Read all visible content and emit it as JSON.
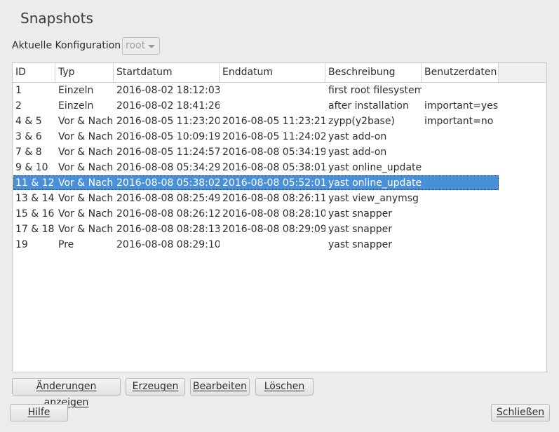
{
  "window": {
    "title": "Snapshots"
  },
  "config": {
    "label": "Aktuelle Konfiguration",
    "value": "root"
  },
  "table": {
    "columns": [
      "ID",
      "Typ",
      "Startdatum",
      "Enddatum",
      "Beschreibung",
      "Benutzerdaten"
    ],
    "rows": [
      [
        "1",
        "Einzeln",
        "2016-08-02 18:12:03",
        "",
        "first root filesystem",
        ""
      ],
      [
        "2",
        "Einzeln",
        "2016-08-02 18:41:26",
        "",
        "after installation",
        "important=yes"
      ],
      [
        "4 & 5",
        "Vor & Nach",
        "2016-08-05 11:23:20",
        "2016-08-05 11:23:21",
        "zypp(y2base)",
        "important=no"
      ],
      [
        "3 & 6",
        "Vor & Nach",
        "2016-08-05 10:09:19",
        "2016-08-05 11:24:02",
        "yast add-on",
        ""
      ],
      [
        "7 & 8",
        "Vor & Nach",
        "2016-08-05 11:24:57",
        "2016-08-08 05:34:19",
        "yast add-on",
        ""
      ],
      [
        "9 & 10",
        "Vor & Nach",
        "2016-08-08 05:34:29",
        "2016-08-08 05:38:01",
        "yast online_update",
        ""
      ],
      [
        "11 & 12",
        "Vor & Nach",
        "2016-08-08 05:38:02",
        "2016-08-08 05:52:01",
        "yast online_update",
        ""
      ],
      [
        "13 & 14",
        "Vor & Nach",
        "2016-08-08 08:25:49",
        "2016-08-08 08:26:11",
        "yast view_anymsg",
        ""
      ],
      [
        "15 & 16",
        "Vor & Nach",
        "2016-08-08 08:26:12",
        "2016-08-08 08:28:10",
        "yast snapper",
        ""
      ],
      [
        "17 & 18",
        "Vor & Nach",
        "2016-08-08 08:28:13",
        "2016-08-08 08:29:09",
        "yast snapper",
        ""
      ],
      [
        "19",
        "Pre",
        "2016-08-08 08:29:10",
        "",
        "yast snapper",
        ""
      ]
    ],
    "selected_row": 6
  },
  "buttons": {
    "show_changes": "Änderungen anzeigen",
    "create": "Erzeugen",
    "edit": "Bearbeiten",
    "delete": "Löschen",
    "help": "Hilfe",
    "close": "Schließen"
  },
  "colors": {
    "selection": "#4a90d9",
    "background": "#ececec"
  }
}
